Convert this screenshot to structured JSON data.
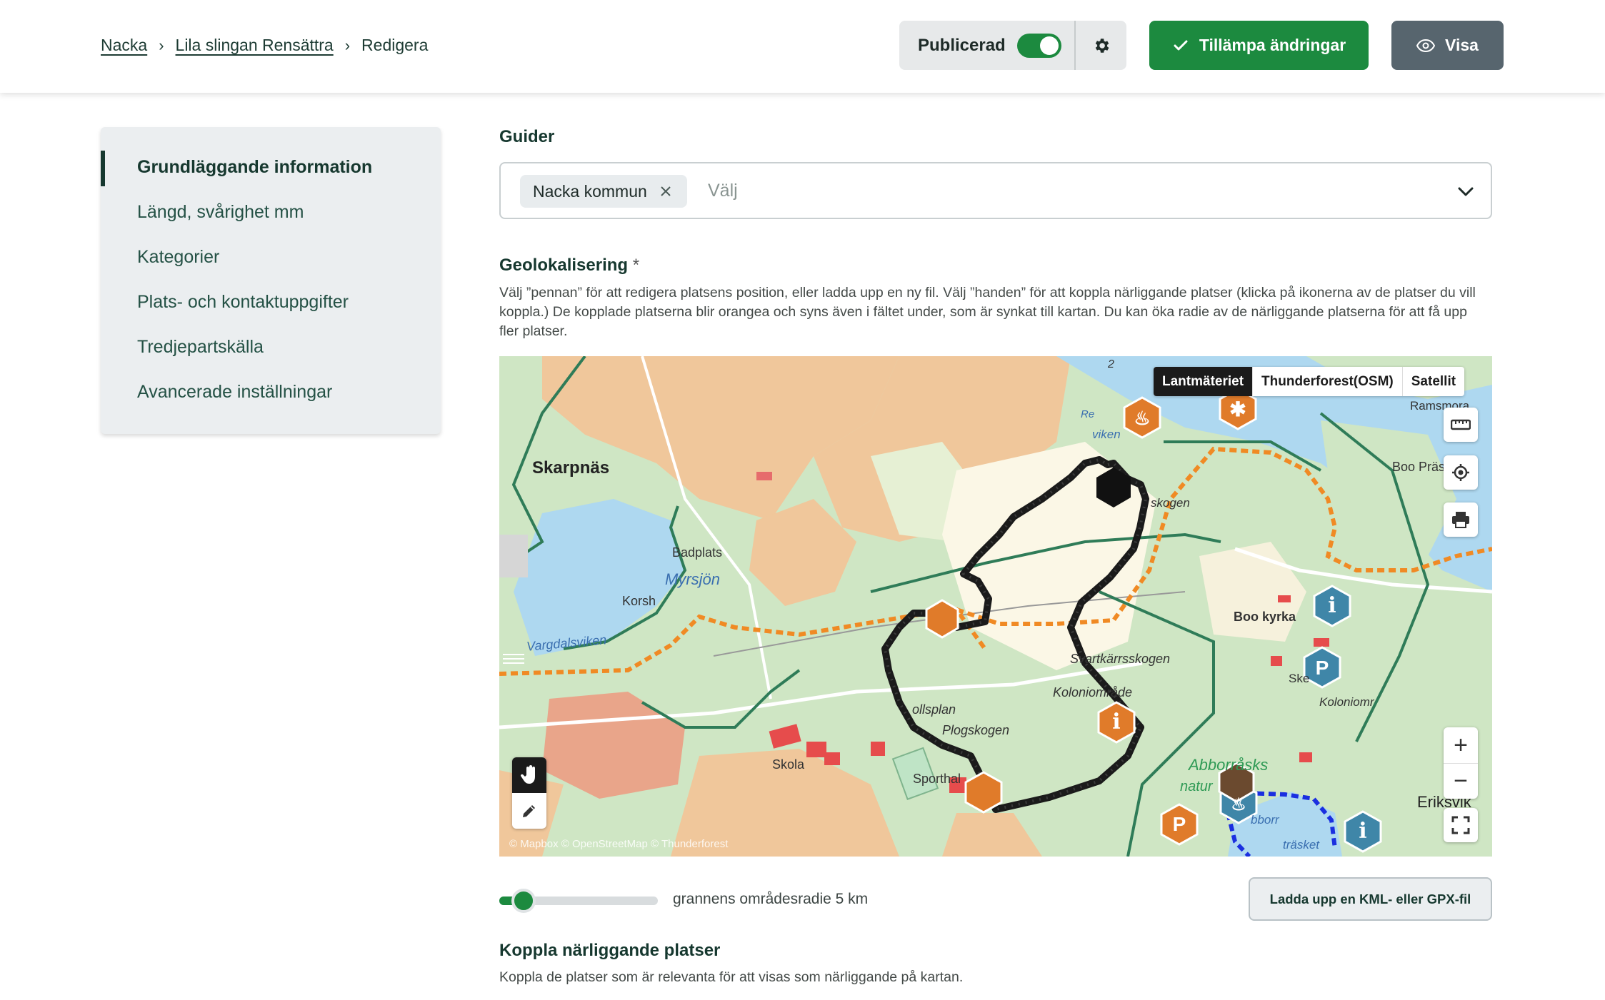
{
  "breadcrumb": {
    "items": [
      "Nacka",
      "Lila slingan Rensättra"
    ],
    "current": "Redigera",
    "separator": "›"
  },
  "header": {
    "published_label": "Publicerad",
    "published": true,
    "apply_label": "Tillämpa ändringar",
    "view_label": "Visa"
  },
  "sidebar": {
    "items": [
      {
        "label": "Grundläggande information",
        "active": true
      },
      {
        "label": "Längd, svårighet mm"
      },
      {
        "label": "Kategorier"
      },
      {
        "label": "Plats- och kontaktuppgifter"
      },
      {
        "label": "Tredjepartskälla"
      },
      {
        "label": "Avancerade inställningar"
      }
    ]
  },
  "guides": {
    "title": "Guider",
    "selected": "Nacka kommun",
    "placeholder": "Välj"
  },
  "geo": {
    "title": "Geolokalisering",
    "required_mark": "*",
    "description": "Välj ”pennan” för att redigera platsens position, eller ladda upp en ny fil. Välj ”handen” för att koppla närliggande platser (klicka på ikonerna av de platser du vill koppla.) De kopplade platserna blir orangea och syns även i fältet under, som är synkat till kartan. Du kan öka radie av de närliggande platserna för att få upp fler platser."
  },
  "map": {
    "layers": [
      "Lantmäteriet",
      "Thunderforest(OSM)",
      "Satellit"
    ],
    "active_layer": "Lantmäteriet",
    "attribution": "© Mapbox © OpenStreetMap © Thunderforest",
    "labels": {
      "skarpnas": "Skarpnäs",
      "badplats": "Badplats",
      "myrsjon": "Myrsjön",
      "korsh": "Korsh",
      "vargdalsviken": "Vargdalsviken",
      "skola": "Skola",
      "sporthal": "Sporthal",
      "ollsplan": "ollsplan",
      "plogskogen": "Plogskogen",
      "svartkarrsskogen": "Svartkärrsskogen",
      "koloniomrade": "Koloniområde",
      "boo_kyrka": "Boo kyrka",
      "boo_prastgard": "Boo Prästgår",
      "ramsmora": "Ramsmora",
      "skogen": "skogen",
      "viken": "viken",
      "re": "Re",
      "abborrasks": "Abborråsks",
      "natur": "natur",
      "trasket": "träsket",
      "sborr": "bborr",
      "eriksvik": "Eriksvik",
      "koloniomr2": "Koloniomr",
      "ske": "Ske",
      "two": "2"
    },
    "zoom_in": "+",
    "zoom_out": "−"
  },
  "radius": {
    "value_km": 5,
    "label": "grannens områdesradie 5 km"
  },
  "upload_label": "Ladda upp en KML- eller GPX-fil",
  "nearby": {
    "title": "Koppla närliggande platser",
    "description": "Koppla de platser som är relevanta för att visas som närliggande på kartan."
  },
  "colors": {
    "brand_green": "#1c8a3f",
    "dark_text": "#16382f",
    "marker_orange": "#e07b2a",
    "marker_blue": "#3f86a8",
    "trail_orange": "#f08a24"
  }
}
